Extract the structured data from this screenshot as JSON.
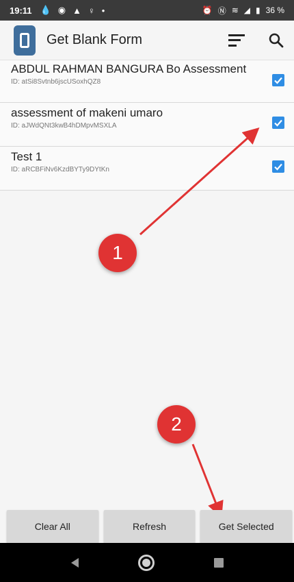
{
  "status_bar": {
    "time": "19:11",
    "battery": "36 %"
  },
  "app_bar": {
    "title": "Get Blank Form"
  },
  "forms": [
    {
      "name": "ABDUL RAHMAN BANGURA Bo Assessment",
      "id": "ID: atSi8Svtnb6jscUSoxhQZ8",
      "checked": true
    },
    {
      "name": "assessment of makeni umaro",
      "id": "ID: aJWdQNt3kwB4hDMpvMSXLA",
      "checked": true
    },
    {
      "name": "Test 1",
      "id": "ID: aRCBFiNv6KzdBYTy9DYtKn",
      "checked": true
    }
  ],
  "annotations": {
    "badge1": "1",
    "badge2": "2",
    "color": "#e03333"
  },
  "buttons": {
    "clear_all": "Clear All",
    "refresh": "Refresh",
    "get_selected": "Get Selected"
  },
  "colors": {
    "checkbox": "#2f8de4",
    "logo": "#3f6e9c"
  }
}
